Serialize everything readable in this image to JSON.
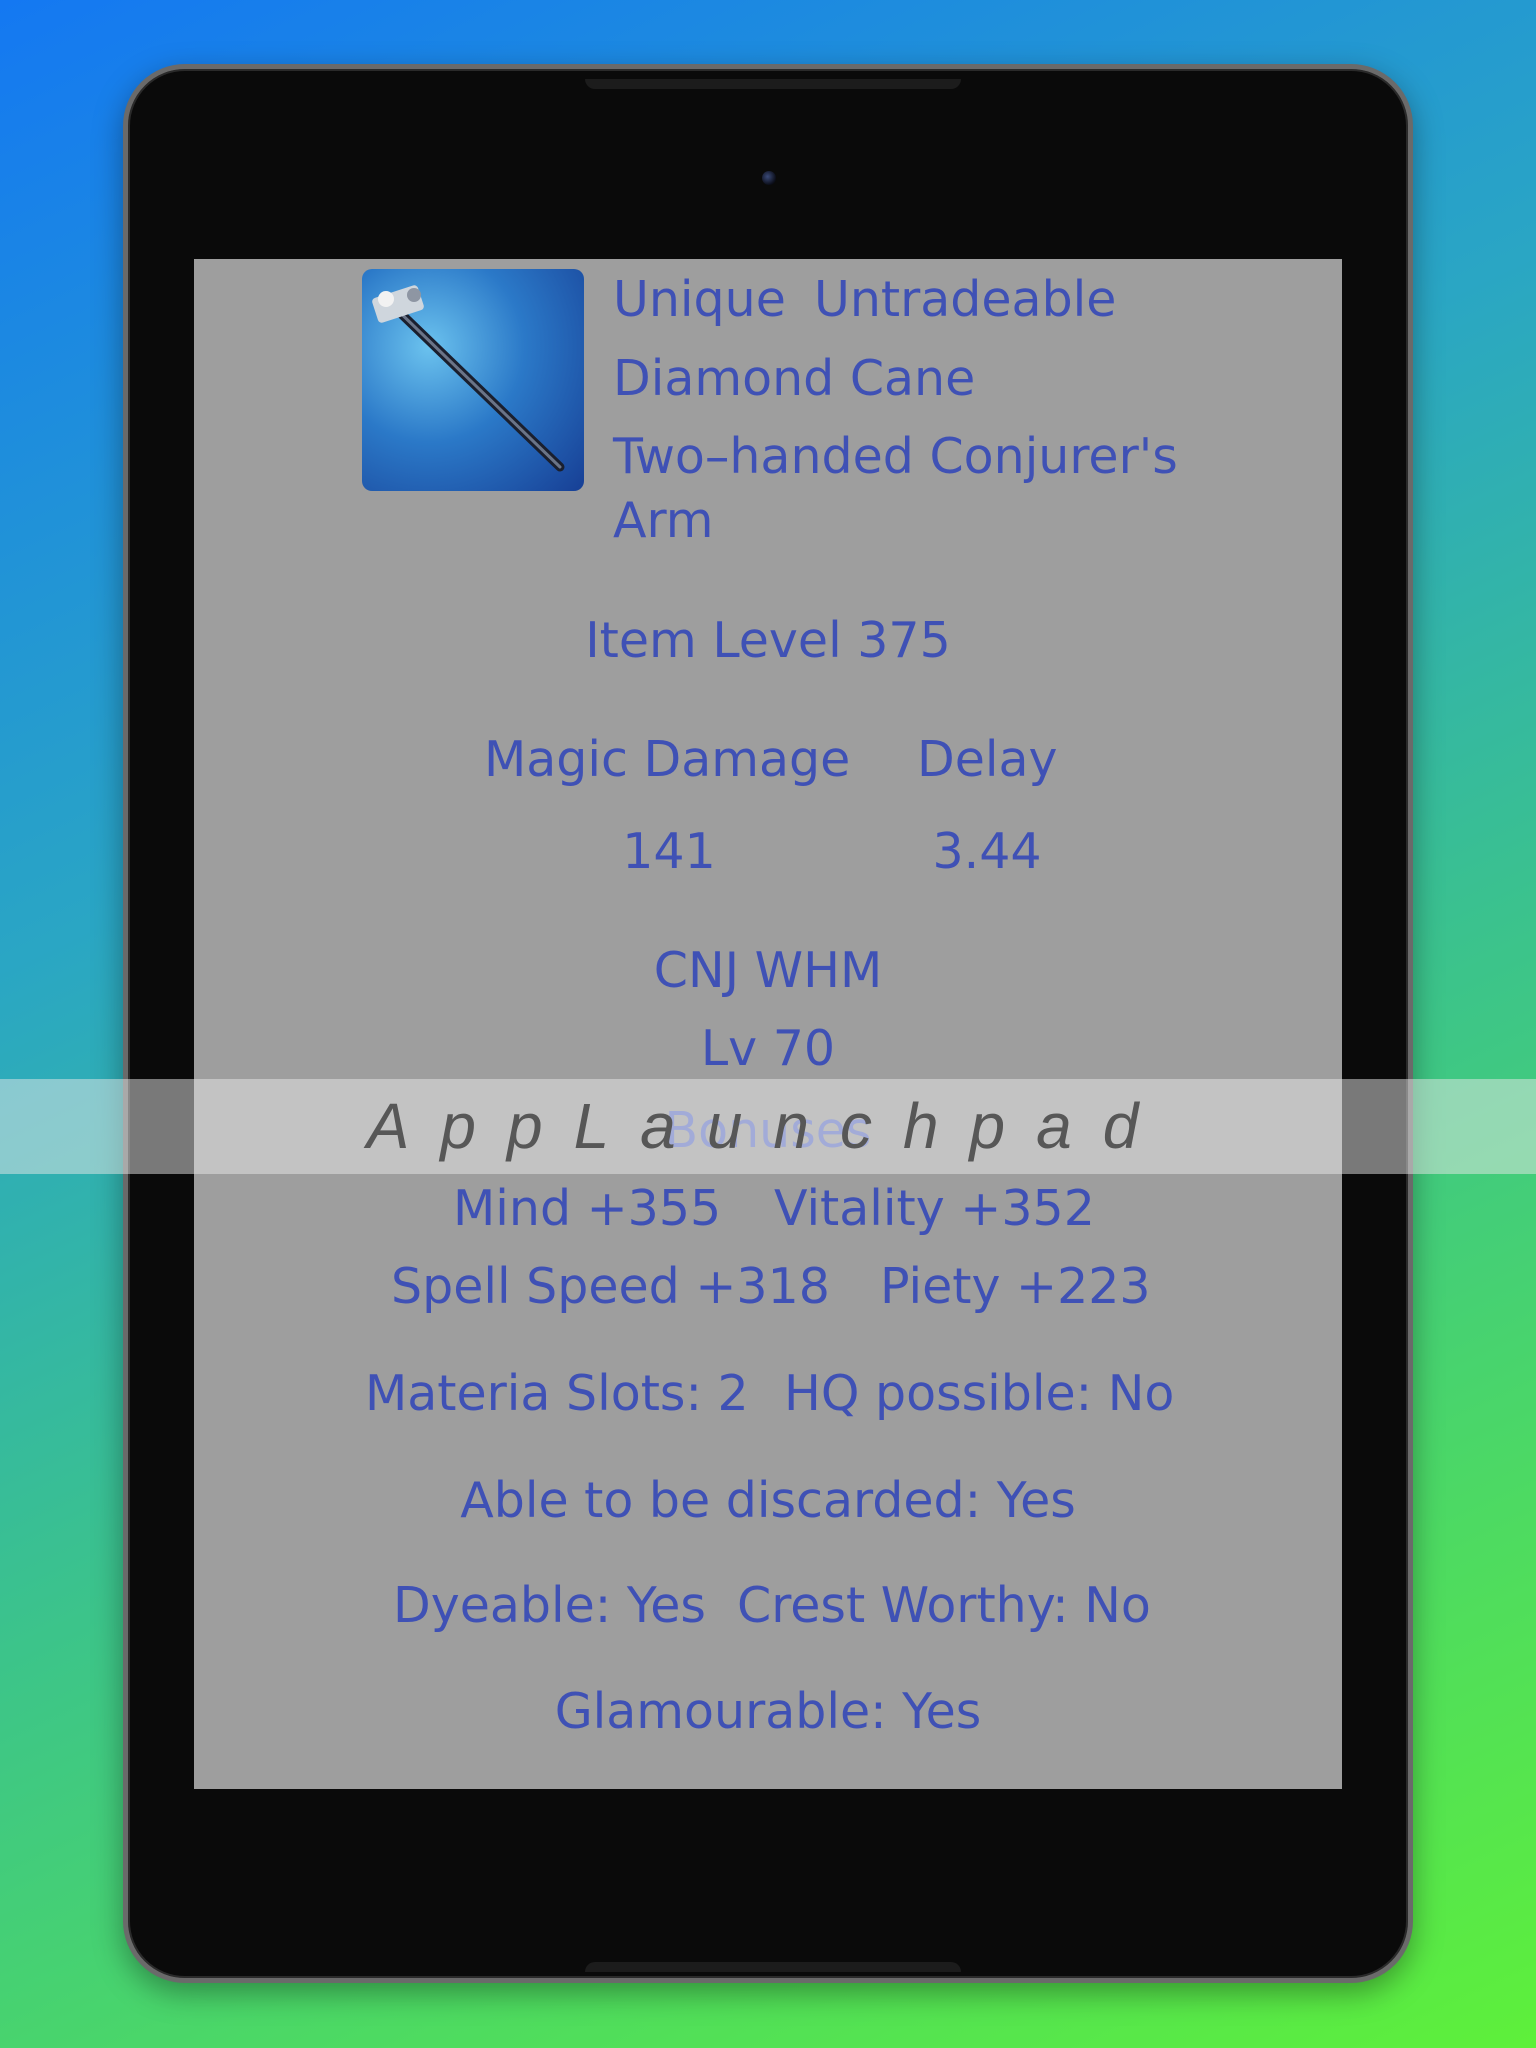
{
  "item": {
    "tags": [
      "Unique",
      "Untradeable"
    ],
    "name": "Diamond Cane",
    "type_line1": "Two–handed Conjurer's",
    "type_line2": "Arm",
    "item_level": "Item Level 375",
    "stats_headers": [
      "Magic Damage",
      "Delay"
    ],
    "stats_values": [
      "141",
      "3.44"
    ],
    "classes": "CNJ WHM",
    "level": "Lv 70",
    "bonuses_title": "Bonuses",
    "bonuses": [
      "Mind +355",
      "Vitality +352",
      "Spell Speed +318",
      "Piety +223"
    ],
    "materia_slots": "Materia Slots: 2",
    "hq_possible": "HQ possible: No",
    "discardable": "Able to be discarded: Yes",
    "dyeable": "Dyeable: Yes",
    "crest_worthy": "Crest Worthy: No",
    "glamourable": "Glamourable: Yes",
    "icon": "staff-icon"
  },
  "watermark": "AppLaunchpad",
  "colors": {
    "text": "#3f51b5",
    "screen_bg": "#9e9e9e"
  }
}
